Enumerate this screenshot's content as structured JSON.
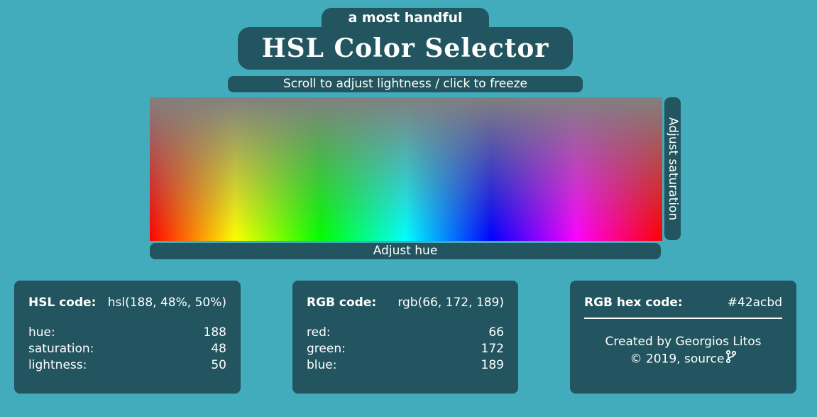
{
  "header": {
    "subtitle": "a most handful",
    "title": "HSL Color Selector",
    "instructions": "Scroll to adjust lightness / click to freeze"
  },
  "picker": {
    "saturation_label": "Adjust saturation",
    "hue_label": "Adjust hue"
  },
  "colors": {
    "background": "#42acbd",
    "panel": "#22555f",
    "text": "#ffffff"
  },
  "hsl_card": {
    "code_label": "HSL code:",
    "code_value": "hsl(188, 48%, 50%)",
    "rows": [
      {
        "label": "hue:",
        "value": "188"
      },
      {
        "label": "saturation:",
        "value": "48"
      },
      {
        "label": "lightness:",
        "value": "50"
      }
    ]
  },
  "rgb_card": {
    "code_label": "RGB code:",
    "code_value": "rgb(66, 172, 189)",
    "rows": [
      {
        "label": "red:",
        "value": "66"
      },
      {
        "label": "green:",
        "value": "172"
      },
      {
        "label": "blue:",
        "value": "189"
      }
    ]
  },
  "hex_card": {
    "code_label": "RGB hex code:",
    "code_value": "#42acbd",
    "credit_line1": "Created by Georgios Litos",
    "credit_line2_prefix": "© 2019,",
    "source_link": "source",
    "source_icon": "git-branch-icon"
  }
}
